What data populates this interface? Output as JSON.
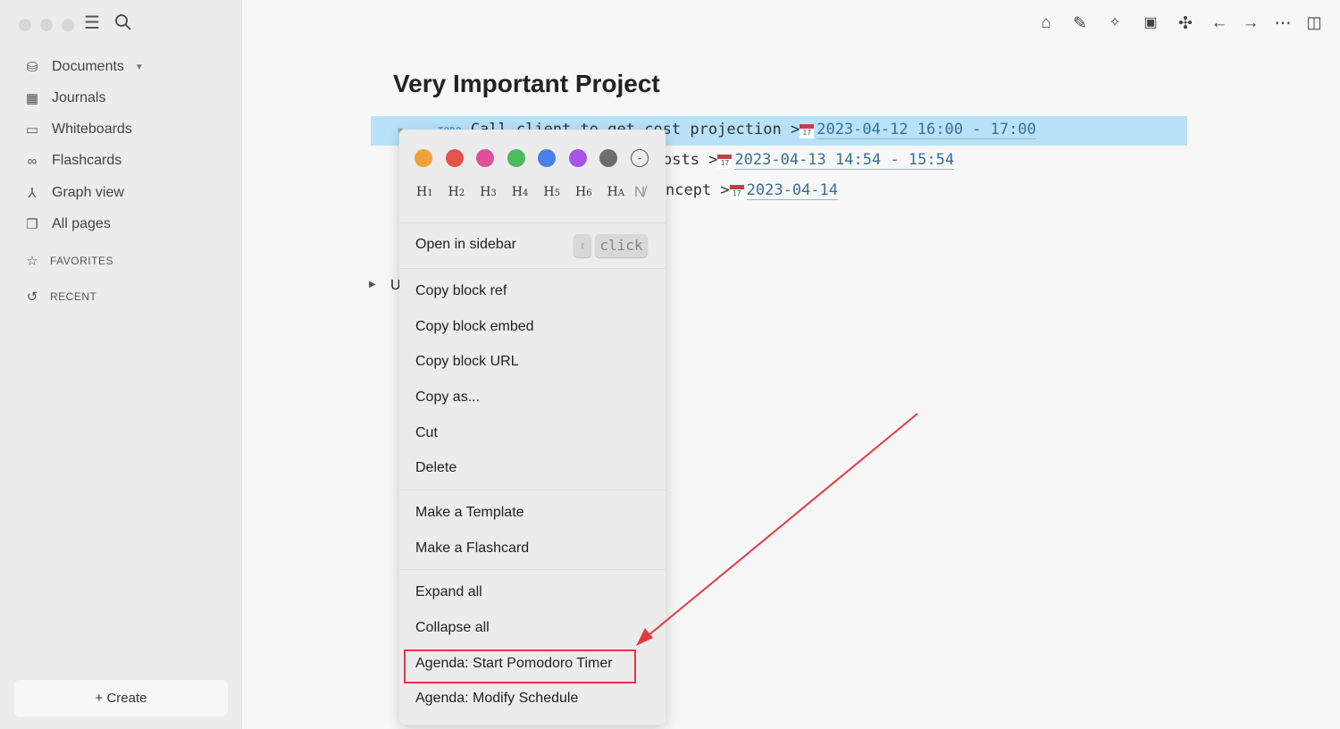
{
  "sidebar": {
    "items": [
      {
        "label": "Documents",
        "icon": "database-icon"
      },
      {
        "label": "Journals",
        "icon": "calendar-icon"
      },
      {
        "label": "Whiteboards",
        "icon": "whiteboard-icon"
      },
      {
        "label": "Flashcards",
        "icon": "infinity-icon"
      },
      {
        "label": "Graph view",
        "icon": "graph-icon"
      },
      {
        "label": "All pages",
        "icon": "pages-icon"
      }
    ],
    "favorites": "FAVORITES",
    "recent": "RECENT",
    "create": "+ Create"
  },
  "page": {
    "title": "Very Important Project",
    "rows": [
      {
        "marker": "TODO",
        "text": "Call client to get cost projection >",
        "date": "2023-04-12 16:00 - 17:00"
      },
      {
        "text": "osts >",
        "date": "2023-04-13 14:54 - 15:54"
      },
      {
        "text": "ncept >",
        "date": "2023-04-14"
      }
    ],
    "collapsed": "U",
    "cal_day": "17"
  },
  "menu": {
    "colors": [
      "#f0a23a",
      "#e5534b",
      "#e0509a",
      "#4dbb5f",
      "#4b80ea",
      "#a653e8",
      "#6d6d6d"
    ],
    "headings": [
      "H1",
      "H2",
      "H3",
      "H4",
      "H5",
      "H6",
      "HA"
    ],
    "open_sidebar": "Open in sidebar",
    "shift_key": "⇧",
    "click_key": "click",
    "items": [
      "Copy block ref",
      "Copy block embed",
      "Copy block URL",
      "Copy as...",
      "Cut",
      "Delete",
      "Make a Template",
      "Make a Flashcard",
      "Expand all",
      "Collapse all",
      "Agenda: Start Pomodoro Timer",
      "Agenda: Modify Schedule"
    ]
  },
  "annotation": {
    "color": "#e53945"
  }
}
